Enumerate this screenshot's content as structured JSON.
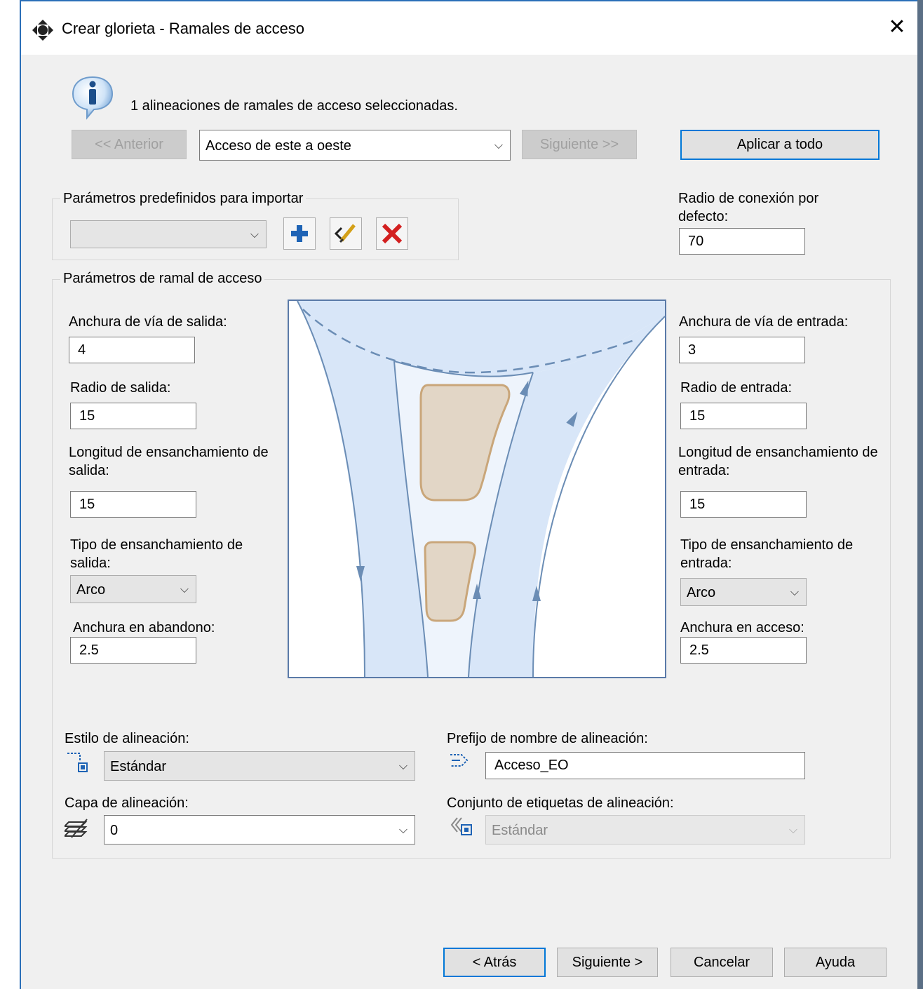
{
  "window": {
    "title": "Crear glorieta - Ramales de acceso"
  },
  "info": {
    "message": "1  alineaciones de ramales de acceso seleccionadas."
  },
  "nav": {
    "previous_label": "<< Anterior",
    "selected_access": "Acceso de este a oeste",
    "next_label": "Siguiente >>",
    "apply_all_label": "Aplicar a todo"
  },
  "presets": {
    "group_title": "Parámetros predefinidos para importar",
    "selected": "",
    "icons": [
      "add-icon",
      "edit-icon",
      "delete-icon"
    ]
  },
  "connection_radius": {
    "label": "Radio de conexión por defecto:",
    "value": "70"
  },
  "ramal": {
    "group_title": "Parámetros de ramal de acceso",
    "exit": {
      "width_label": "Anchura de vía de salida:",
      "width_value": "4",
      "radius_label": "Radio de salida:",
      "radius_value": "15",
      "flare_length_label": "Longitud de ensanchamiento de salida:",
      "flare_length_value": "15",
      "flare_type_label": "Tipo de ensanchamiento de salida:",
      "flare_type_value": "Arco",
      "abandon_width_label": "Anchura en abandono:",
      "abandon_width_value": "2.5"
    },
    "entry": {
      "width_label": "Anchura de vía de entrada:",
      "width_value": "3",
      "radius_label": "Radio de entrada:",
      "radius_value": "15",
      "flare_length_label": "Longitud de ensanchamiento de entrada:",
      "flare_length_value": "15",
      "flare_type_label": "Tipo de ensanchamiento de entrada:",
      "flare_type_value": "Arco",
      "access_width_label": "Anchura en acceso:",
      "access_width_value": "2.5"
    }
  },
  "alignment": {
    "style_label": "Estilo de alineación:",
    "style_value": "Estándar",
    "layer_label": "Capa de alineación:",
    "layer_value": "0",
    "prefix_label": "Prefijo de nombre de alineación:",
    "prefix_value": "Acceso_EO",
    "labelset_label": "Conjunto de etiquetas de alineación:",
    "labelset_value": "Estándar"
  },
  "footer": {
    "back": "< Atrás",
    "next": "Siguiente >",
    "cancel": "Cancelar",
    "help": "Ayuda"
  },
  "colors": {
    "accent": "#0078d7",
    "road": "#d6e4f7",
    "island": "#e2d6c6",
    "island_border": "#c9a67a",
    "road_line": "#6b8db5"
  }
}
